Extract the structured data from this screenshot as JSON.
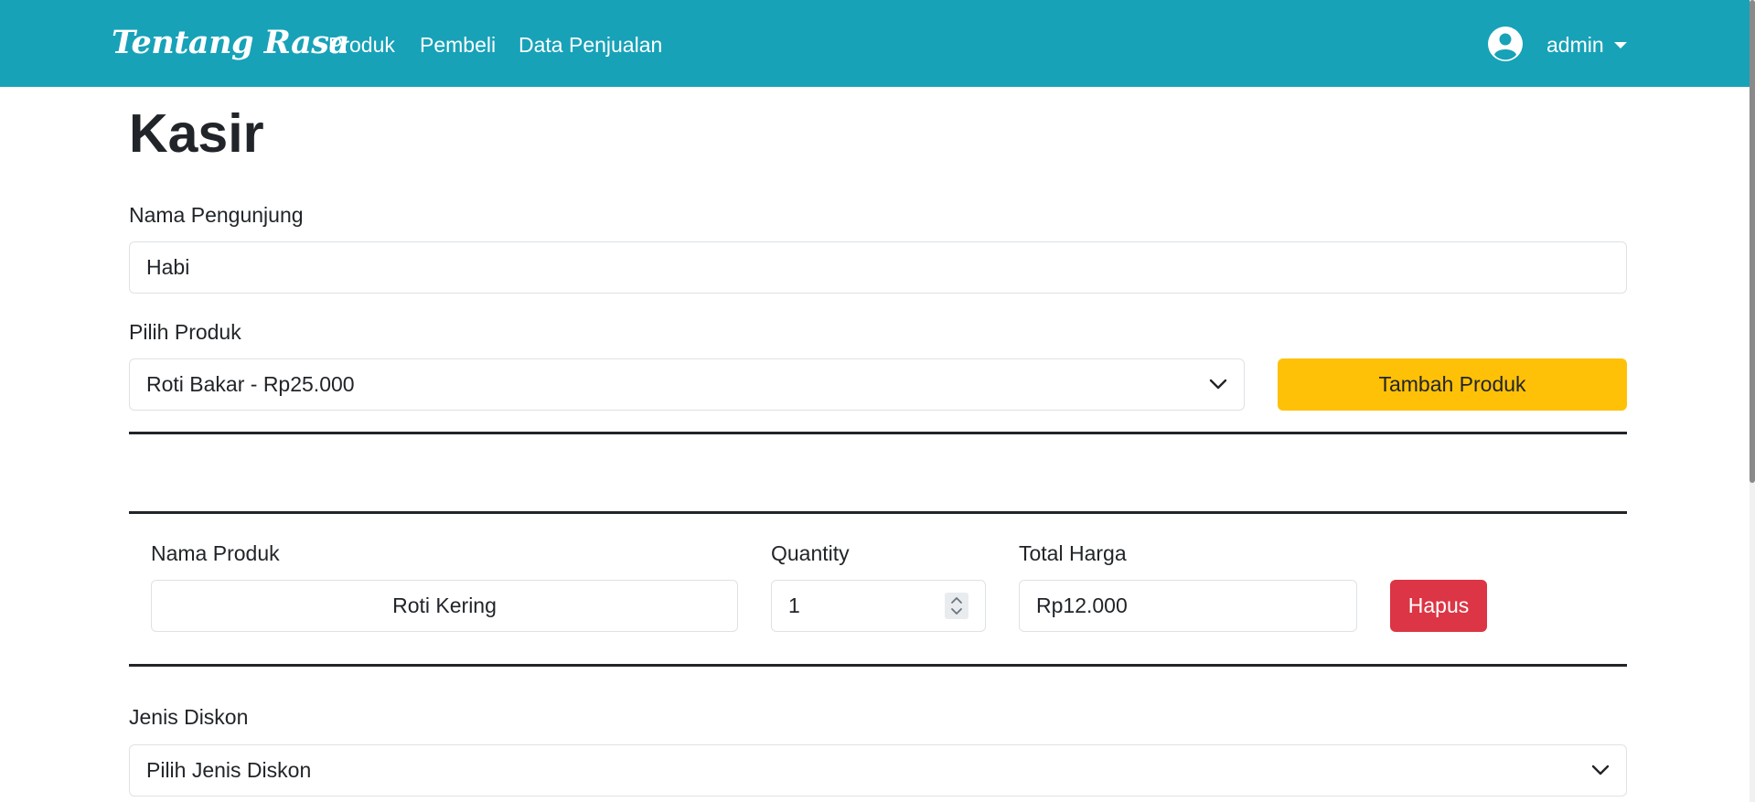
{
  "navbar": {
    "brand": "Tentang Rasa",
    "links": [
      "Produk",
      "Pembeli",
      "Data Penjualan"
    ],
    "user": "admin",
    "user_icon": "user-circle-icon",
    "bg_color": "#17a2b8"
  },
  "page": {
    "title": "Kasir"
  },
  "form": {
    "visitor_label": "Nama Pengunjung",
    "visitor_value": "Habi",
    "product_label": "Pilih Produk",
    "product_selected": "Roti Bakar - Rp25.000",
    "add_button": "Tambah Produk"
  },
  "cart": {
    "headers": {
      "name": "Nama Produk",
      "quantity": "Quantity",
      "total": "Total Harga"
    },
    "items": [
      {
        "name": "Roti Kering",
        "quantity": "1",
        "total": "Rp12.000",
        "delete_label": "Hapus"
      }
    ]
  },
  "discount": {
    "label": "Jenis Diskon",
    "selected": "Pilih Jenis Diskon"
  },
  "colors": {
    "warning": "#ffc107",
    "danger": "#dc3545"
  }
}
